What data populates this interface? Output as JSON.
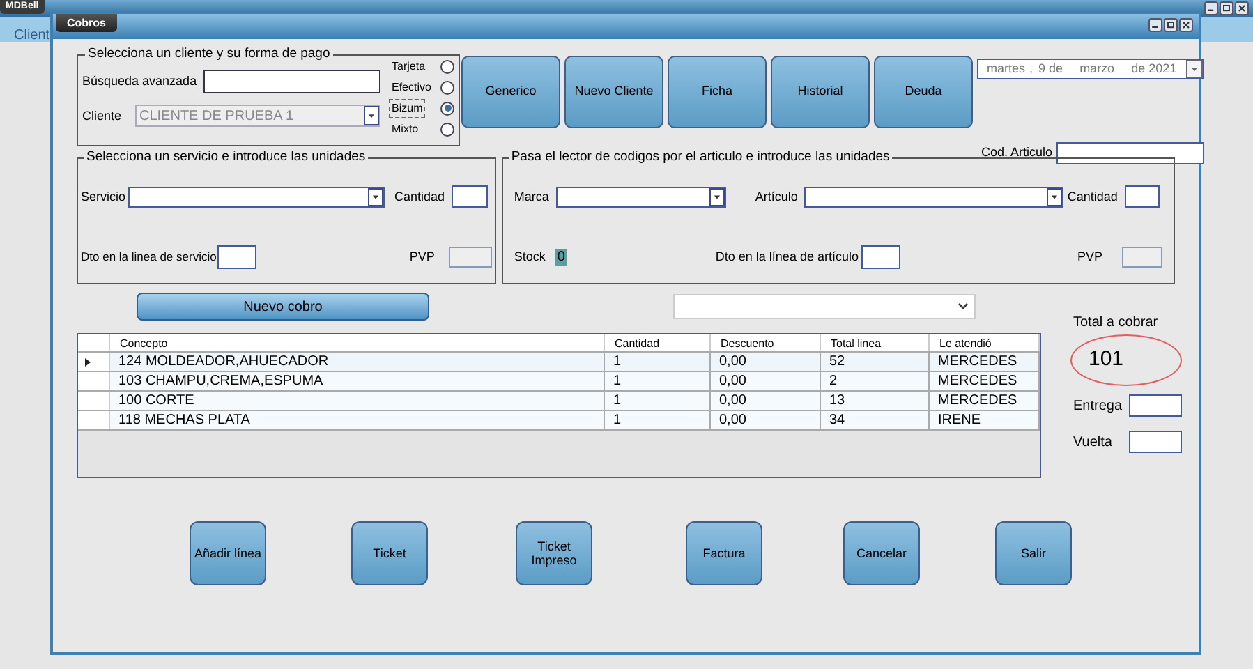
{
  "window": {
    "app_tab": "MDBell",
    "app_menu": "Client",
    "title": "Cobros"
  },
  "client_group": {
    "legend": "Selecciona un cliente y su forma de pago",
    "search_label": "Búsqueda avanzada",
    "client_label": "Cliente",
    "client_value": "CLIENTE DE PRUEBA 1",
    "payment_methods": [
      {
        "label": "Tarjeta",
        "selected": false
      },
      {
        "label": "Efectivo",
        "selected": false
      },
      {
        "label": "Bizum",
        "selected": true
      },
      {
        "label": "Mixto",
        "selected": false
      }
    ]
  },
  "top_buttons": [
    "Generico",
    "Nuevo Cliente",
    "Ficha",
    "Historial",
    "Deuda"
  ],
  "date": {
    "weekday": "martes",
    "separator": ",",
    "day": "9 de",
    "month": "marzo",
    "year": "de 2021"
  },
  "code_label": "Cod. Articulo",
  "service_group": {
    "legend": "Selecciona un servicio e introduce las unidades",
    "service_label": "Servicio",
    "quantity_label": "Cantidad",
    "discount_label": "Dto en la linea de servicio",
    "price_label": "PVP"
  },
  "article_group": {
    "legend": "Pasa el lector de codigos por el articulo e introduce las unidades",
    "brand_label": "Marca",
    "article_label": "Artículo",
    "quantity_label": "Cantidad",
    "stock_label": "Stock",
    "stock_value": "0",
    "discount_label": "Dto en la línea de artículo",
    "price_label": "PVP"
  },
  "new_charge_button": "Nuevo cobro",
  "table": {
    "columns": [
      "Concepto",
      "Cantidad",
      "Descuento",
      "Total linea",
      "Le atendió"
    ],
    "rows": [
      {
        "selected": true,
        "cells": [
          "124 MOLDEADOR,AHUECADOR",
          "1",
          "0,00",
          "52",
          "MERCEDES"
        ]
      },
      {
        "selected": false,
        "cells": [
          "103 CHAMPU,CREMA,ESPUMA",
          "1",
          "0,00",
          "2",
          "MERCEDES"
        ]
      },
      {
        "selected": false,
        "cells": [
          "100 CORTE",
          "1",
          "0,00",
          "13",
          "MERCEDES"
        ]
      },
      {
        "selected": false,
        "cells": [
          "118 MECHAS PLATA",
          "1",
          "0,00",
          "34",
          "IRENE"
        ]
      }
    ]
  },
  "totals": {
    "total_label": "Total a cobrar",
    "total": "101",
    "given_label": "Entrega",
    "change_label": "Vuelta"
  },
  "actions": [
    "Añadir línea",
    "Ticket",
    "Ticket Impreso",
    "Factura",
    "Cancelar",
    "Salir"
  ]
}
